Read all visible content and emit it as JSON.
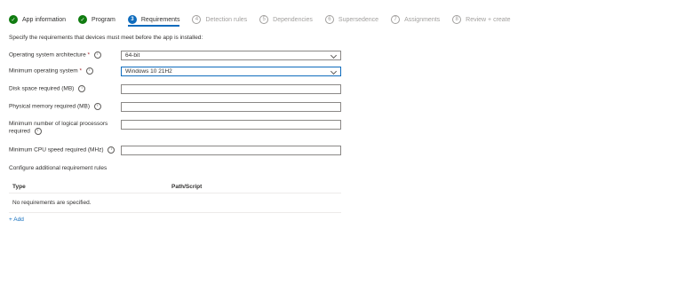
{
  "wizard": {
    "steps": [
      {
        "label": "App information",
        "state": "done",
        "marker": "✓"
      },
      {
        "label": "Program",
        "state": "done",
        "marker": "✓"
      },
      {
        "label": "Requirements",
        "state": "current",
        "marker": "3"
      },
      {
        "label": "Detection rules",
        "state": "pending",
        "marker": "4"
      },
      {
        "label": "Dependencies",
        "state": "pending",
        "marker": "5"
      },
      {
        "label": "Supersedence",
        "state": "pending",
        "marker": "6"
      },
      {
        "label": "Assignments",
        "state": "pending",
        "marker": "7"
      },
      {
        "label": "Review + create",
        "state": "pending",
        "marker": "8"
      }
    ]
  },
  "intro": "Specify the requirements that devices must meet before the app is installed:",
  "fields": {
    "os_architecture": {
      "label": "Operating system architecture",
      "required": "*",
      "value": "64-bit"
    },
    "min_os": {
      "label": "Minimum operating system",
      "required": "*",
      "value": "Windows 10 21H2"
    },
    "disk_space": {
      "label": "Disk space required (MB)",
      "value": ""
    },
    "physical_memory": {
      "label": "Physical memory required (MB)",
      "value": ""
    },
    "logical_processors": {
      "label": "Minimum number of logical processors required",
      "value": ""
    },
    "cpu_speed": {
      "label": "Minimum CPU speed required (MHz)",
      "value": ""
    }
  },
  "additional": {
    "title": "Configure additional requirement rules",
    "columns": [
      "Type",
      "Path/Script"
    ],
    "empty_text": "No requirements are specified.",
    "add_label": "+ Add"
  },
  "icons": {
    "info": "info-icon",
    "check": "checkmark-icon",
    "chevron": "chevron-down-icon"
  },
  "colors": {
    "accent": "#0f6cbd",
    "done": "#107c10",
    "required": "#a4262c",
    "pending": "#a19f9d"
  }
}
